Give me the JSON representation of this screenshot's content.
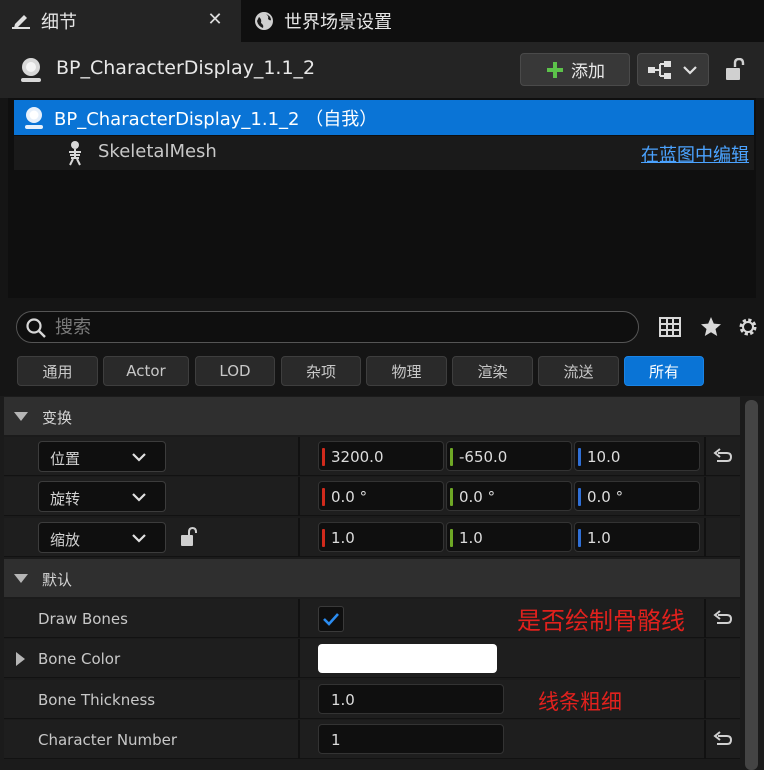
{
  "tabs": [
    {
      "label": "细节",
      "icon": "pencil-icon",
      "active": true
    },
    {
      "label": "世界场景设置",
      "icon": "globe-icon",
      "active": false
    }
  ],
  "actor": {
    "title": "BP_CharacterDisplay_1.1_2",
    "add_label": "添加"
  },
  "components": {
    "self_label": "BP_CharacterDisplay_1.1_2 （自我）",
    "mesh_label": "SkeletalMesh",
    "edit_link": "在蓝图中编辑"
  },
  "search": {
    "placeholder": "搜索"
  },
  "filters": [
    "通用",
    "Actor",
    "LOD",
    "杂项",
    "物理",
    "渲染",
    "流送",
    "所有"
  ],
  "active_filter": "所有",
  "transform": {
    "category": "变换",
    "location": {
      "label": "位置",
      "x": "3200.0",
      "y": "-650.0",
      "z": "10.0"
    },
    "rotation": {
      "label": "旋转",
      "x": "0.0 °",
      "y": "0.0 °",
      "z": "0.0 °"
    },
    "scale": {
      "label": "缩放",
      "x": "1.0",
      "y": "1.0",
      "z": "1.0"
    }
  },
  "default": {
    "category": "默认",
    "draw_bones": {
      "label": "Draw Bones",
      "checked": true
    },
    "bone_color": {
      "label": "Bone Color",
      "value": "#ffffff"
    },
    "bone_thickness": {
      "label": "Bone Thickness",
      "value": "1.0"
    },
    "character_number": {
      "label": "Character Number",
      "value": "1"
    }
  },
  "annotations": {
    "draw_bones_note": "是否绘制骨骼线",
    "thickness_note": "线条粗细"
  },
  "colors": {
    "accent": "#0a74d6",
    "axis_x": "#d12a1c",
    "axis_y": "#6ea825",
    "axis_z": "#2f6fd6",
    "annotation": "#e0211d"
  }
}
